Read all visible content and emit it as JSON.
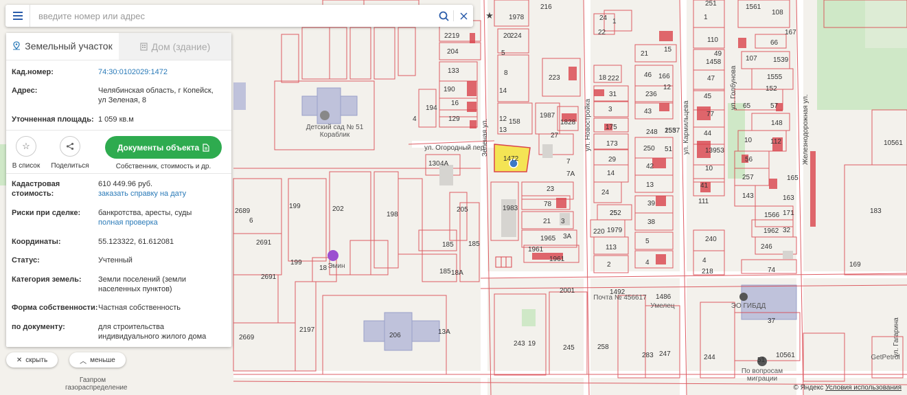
{
  "search": {
    "placeholder": "введите номер или адрес"
  },
  "tabs": [
    {
      "label": "Земельный участок",
      "active": true,
      "icon": "map-pin-icon"
    },
    {
      "label": "Дом (здание)",
      "active": false,
      "icon": "building-icon"
    }
  ],
  "details": {
    "cadastral_label": "Кад.номер:",
    "cadastral_value": "74:30:0102029:1472",
    "address_label": "Адрес:",
    "address_value": "Челябинская область, г Копейск, ул Зеленая, 8",
    "area_label": "Уточненная площадь:",
    "area_value": "1 059 кв.м",
    "value_label": "Кадастровая стоимость:",
    "value_value": "610 449.96 руб.",
    "value_link": "заказать справку на дату",
    "risk_label": "Риски при сделке:",
    "risk_value": "банкротства, аресты, суды",
    "risk_link": "полная проверка",
    "coords_label": "Координаты:",
    "coords_value": "55.123322, 61.612081",
    "status_label": "Статус:",
    "status_value": "Учтенный",
    "category_label": "Категория земель:",
    "category_value": "Земли поселений (земли населенных пунктов)",
    "ownership_label": "Форма собственности:",
    "ownership_value": "Частная собственность",
    "purpose_label": "по документу:",
    "purpose_value": "для строительства индивидуального жилого дома"
  },
  "actions": {
    "list_label": "В список",
    "share_label": "Поделиться",
    "docs_button": "Документы объекта",
    "docs_sub": "Собственник, стоимость и др."
  },
  "bottom": {
    "hide_label": "скрыть",
    "less_label": "меньше"
  },
  "attribution": {
    "copyright": "© Яндекс",
    "terms": "Условия использования"
  },
  "colors": {
    "accent": "#2a5caa",
    "green_button": "#2eab4f",
    "boundary": "#d9434b",
    "building": "#d9434b",
    "selected_parcel": "#f3e23a",
    "pin": "#3b78c6"
  },
  "map_labels": {
    "parcel_numbers": [
      "1978",
      "224",
      "20",
      "216",
      "2219",
      "204",
      "133",
      "190",
      "16",
      "194",
      "129",
      "158",
      "1987",
      "1828",
      "27",
      "223",
      "12",
      "13",
      "14",
      "4",
      "5",
      "8",
      "130",
      "4A",
      "1472",
      "7",
      "7А",
      "23",
      "78",
      "21",
      "3",
      "1983",
      "1965",
      "3А",
      "1961",
      "1961",
      "185",
      "185",
      "18A",
      "185",
      "205",
      "198",
      "202",
      "199",
      "2691",
      "2691",
      "2689",
      "6",
      "199",
      "18",
      "2197",
      "2669",
      "206",
      "13A",
      "243",
      "19",
      "245",
      "258",
      "1492",
      "2001",
      "1486",
      "283",
      "247",
      "244",
      "24",
      "1",
      "22",
      "18",
      "222",
      "31",
      "3",
      "175",
      "173",
      "29",
      "14",
      "24",
      "252",
      "25",
      "220",
      "1979",
      "113",
      "2",
      "15",
      "12",
      "1537",
      "248",
      "21",
      "46",
      "166",
      "236",
      "43",
      "250",
      "42",
      "13",
      "39",
      "38",
      "5",
      "4",
      "255",
      "51",
      "251",
      "110",
      "49",
      "1458",
      "47",
      "45",
      "77",
      "44",
      "13953",
      "10",
      "41",
      "111",
      "240",
      "4",
      "218",
      "1",
      "1561",
      "108",
      "66",
      "107",
      "1539",
      "1555",
      "152",
      "65",
      "57",
      "148",
      "10",
      "112",
      "56",
      "257",
      "143",
      "1566",
      "1962",
      "246",
      "74",
      "37",
      "51",
      "10561",
      "10561",
      "183",
      "169",
      "167",
      "165",
      "163",
      "171",
      "32"
    ],
    "streets": [
      "Зеленая ул.",
      "ул. Новостройка",
      "ул. Кармильцева",
      "ул. Голбунова",
      "ул. Огородный пер.",
      "Железнодорожная ул.",
      "ул. Гагарина"
    ],
    "pois": [
      "Детский сад № 51 Кораблик",
      "Почта № 456617",
      "Умелец",
      "ЭО ГИБДД",
      "Газпром газораспределение",
      "Эмин",
      "По вопросам миграции",
      "GetPetrol"
    ]
  }
}
